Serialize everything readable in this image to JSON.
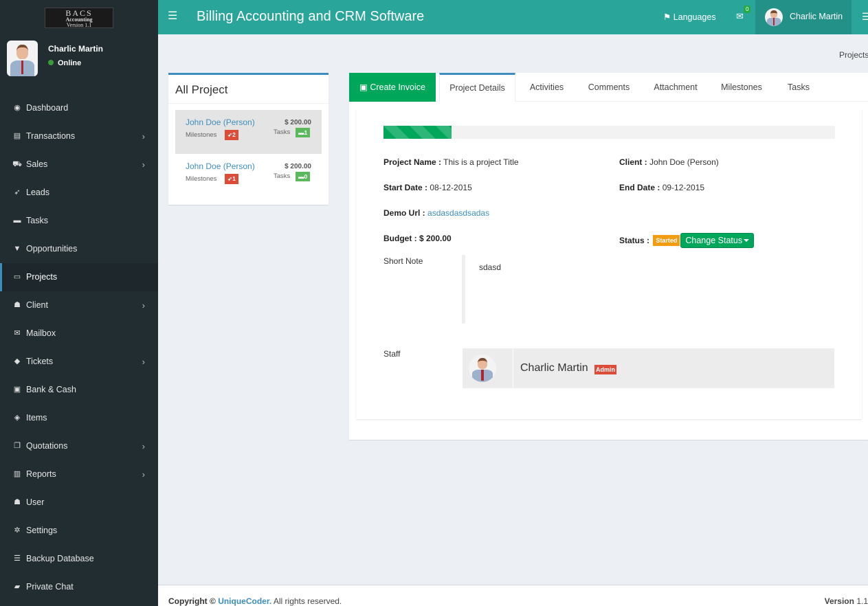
{
  "logo": {
    "line1": "BACS",
    "line2": "Accounting",
    "line3": "Version 1.1"
  },
  "user": {
    "name": "Charlic Martin",
    "status": "Online"
  },
  "menu": [
    {
      "label": "Dashboard",
      "icon": "dashboard-icon",
      "glyph": "◉",
      "chevron": false
    },
    {
      "label": "Transactions",
      "icon": "transactions-icon",
      "glyph": "▤",
      "chevron": true
    },
    {
      "label": "Sales",
      "icon": "cart-icon",
      "glyph": "⛟",
      "chevron": true
    },
    {
      "label": "Leads",
      "icon": "rocket-icon",
      "glyph": "➶",
      "chevron": false
    },
    {
      "label": "Tasks",
      "icon": "tasks-icon",
      "glyph": "▬",
      "chevron": false
    },
    {
      "label": "Opportunities",
      "icon": "filter-icon",
      "glyph": "▼",
      "chevron": false
    },
    {
      "label": "Projects",
      "icon": "folder-open-icon",
      "glyph": "▭",
      "chevron": false,
      "active": true
    },
    {
      "label": "Client",
      "icon": "users-icon",
      "glyph": "☗",
      "chevron": true
    },
    {
      "label": "Mailbox",
      "icon": "envelope-icon",
      "glyph": "✉",
      "chevron": false
    },
    {
      "label": "Tickets",
      "icon": "ticket-icon",
      "glyph": "◆",
      "chevron": true
    },
    {
      "label": "Bank & Cash",
      "icon": "money-icon",
      "glyph": "▣",
      "chevron": false
    },
    {
      "label": "Items",
      "icon": "cube-icon",
      "glyph": "◈",
      "chevron": false
    },
    {
      "label": "Quotations",
      "icon": "file-icon",
      "glyph": "❐",
      "chevron": true
    },
    {
      "label": "Reports",
      "icon": "bar-chart-icon",
      "glyph": "▥",
      "chevron": true
    },
    {
      "label": "User",
      "icon": "user-group-icon",
      "glyph": "☗",
      "chevron": false
    },
    {
      "label": "Settings",
      "icon": "cogs-icon",
      "glyph": "✲",
      "chevron": false
    },
    {
      "label": "Backup Database",
      "icon": "database-icon",
      "glyph": "☰",
      "chevron": false
    },
    {
      "label": "Private Chat",
      "icon": "comment-icon",
      "glyph": "▰",
      "chevron": false
    }
  ],
  "header": {
    "title": "Billing Accounting and CRM Software",
    "languages": "Languages",
    "mail_count": "0",
    "user_name": "Charlic Martin"
  },
  "breadcrumb": "Projects",
  "projects": {
    "title": "All Project",
    "milestones_label": "Milestones",
    "tasks_label": "Tasks",
    "items": [
      {
        "name": "John Doe (Person)",
        "amount": "$ 200.00",
        "milestones": "2",
        "tasks": "1",
        "selected": true
      },
      {
        "name": "John Doe (Person)",
        "amount": "$ 200.00",
        "milestones": "1",
        "tasks": "0",
        "selected": false
      }
    ]
  },
  "tabs": {
    "create_invoice": "Create Invoice",
    "items": [
      "Project Details",
      "Activities",
      "Comments",
      "Attachment",
      "Milestones",
      "Tasks"
    ],
    "active": "Project Details"
  },
  "details": {
    "progress_fraction": 0.15,
    "project_name_label": "Project Name :",
    "project_name": "This is a project Title",
    "client_label": "Client :",
    "client": "John Doe (Person)",
    "start_label": "Start Date :",
    "start_date": "08-12-2015",
    "end_label": "End Date :",
    "end_date": "09-12-2015",
    "demo_label": "Demo Url :",
    "demo_url": "asdasdasdsadas",
    "budget_label": "Budget :",
    "budget": "$ 200.00",
    "status_label": "Status :",
    "status": "Started",
    "change_status": "Change Status",
    "short_note_label": "Short Note",
    "short_note": "sdasd",
    "staff_label": "Staff",
    "staff_name": "Charlic Martin",
    "staff_role": "Admin"
  },
  "footer": {
    "copyright_prefix": "Copyright ©",
    "company": "UniqueCoder.",
    "rights": "All rights reserved.",
    "version_label": "Version",
    "version": "1.1"
  },
  "colors": {
    "header": "#2aa59a",
    "sidebar": "#222d32",
    "accent_blue": "#3c8dbc",
    "green": "#00a65a",
    "red": "#dd4b39",
    "orange": "#f39c12"
  }
}
